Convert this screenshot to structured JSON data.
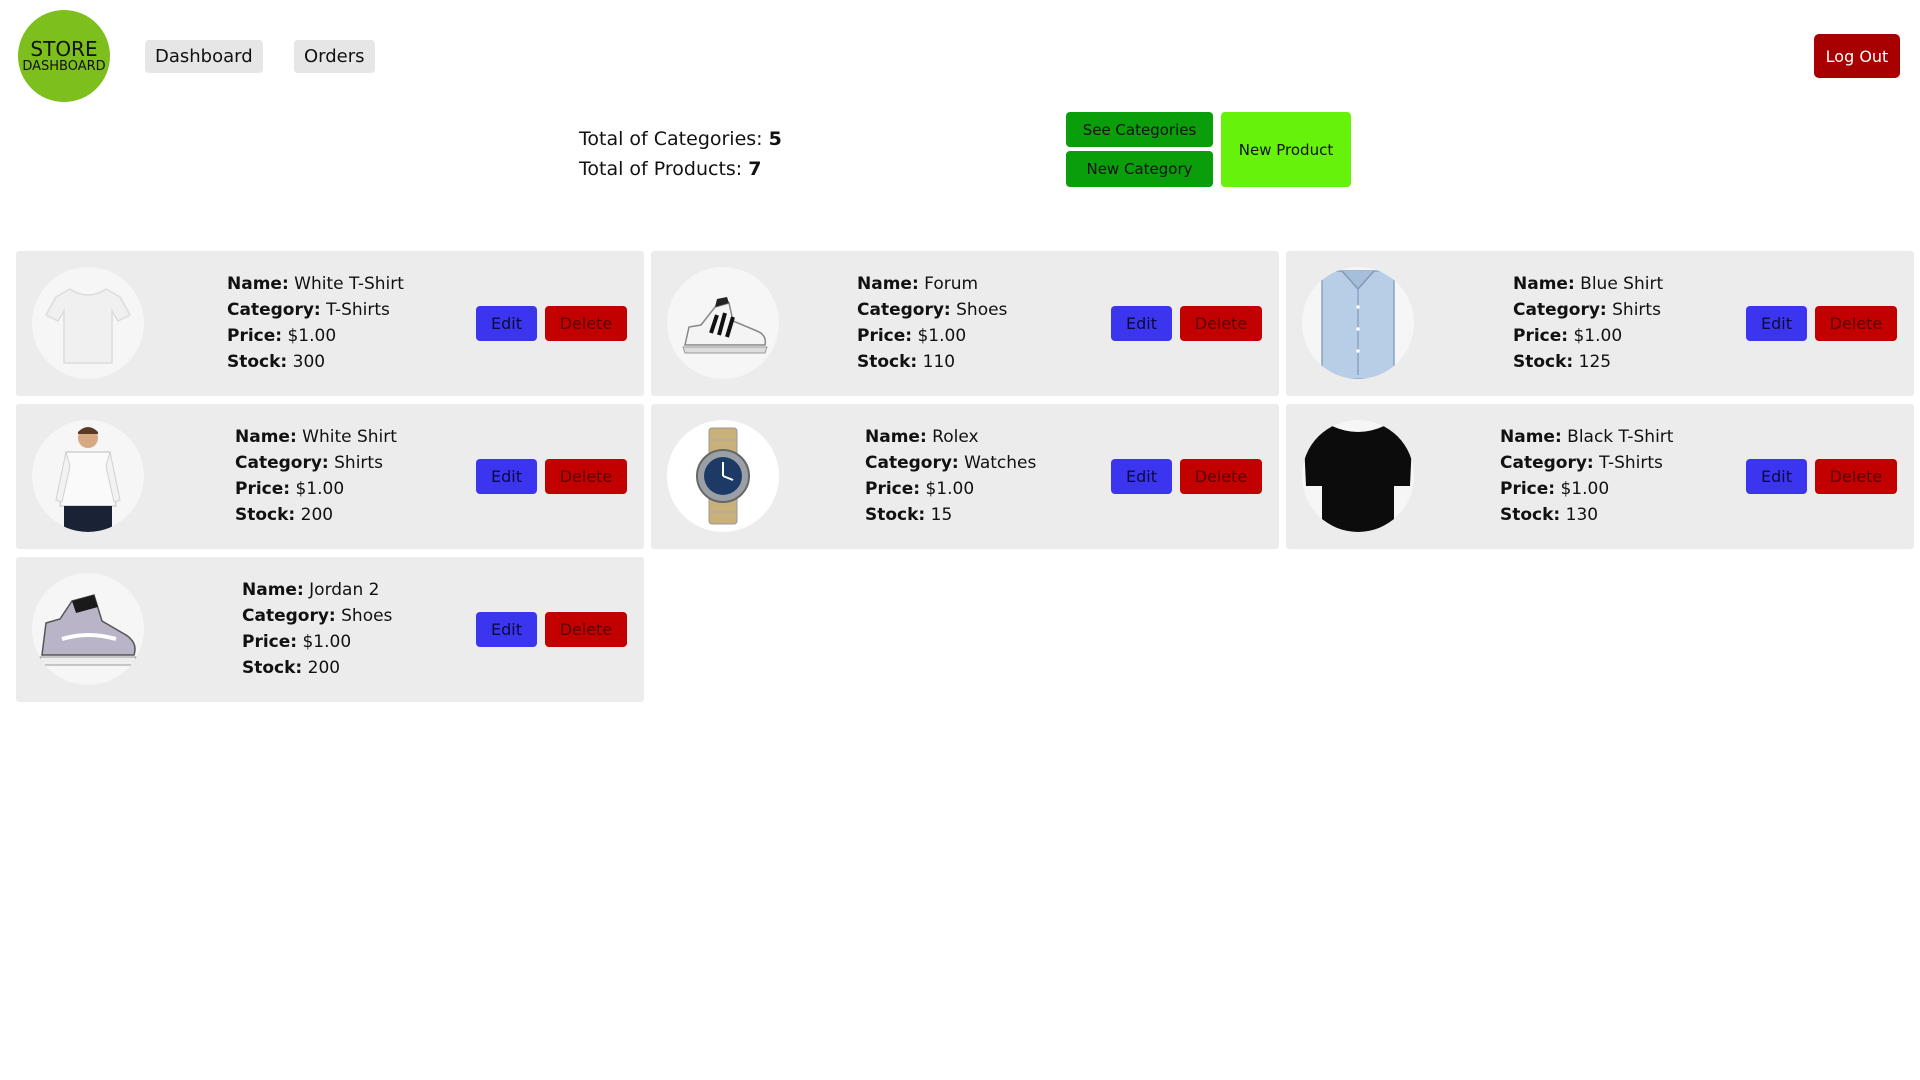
{
  "logo": {
    "line1": "STORE",
    "line2": "DASHBOARD"
  },
  "nav": {
    "dashboard": "Dashboard",
    "orders": "Orders",
    "logout": "Log Out"
  },
  "summary": {
    "categories_label": "Total of Categories:",
    "categories_value": "5",
    "products_label": "Total of Products:",
    "products_value": "7"
  },
  "actions": {
    "see_categories": "See Categories",
    "new_category": "New Category",
    "new_product": "New Product"
  },
  "labels": {
    "name": "Name:",
    "category": "Category:",
    "price": "Price:",
    "stock": "Stock:",
    "edit": "Edit",
    "delete": "Delete"
  },
  "products": [
    {
      "name": "White T-Shirt",
      "category": "T-Shirts",
      "price": "$1.00",
      "stock": "300",
      "image": "white-tshirt-icon"
    },
    {
      "name": "Forum",
      "category": "Shoes",
      "price": "$1.00",
      "stock": "110",
      "image": "sneaker-icon"
    },
    {
      "name": "Blue Shirt",
      "category": "Shirts",
      "price": "$1.00",
      "stock": "125",
      "image": "blue-shirt-icon"
    },
    {
      "name": "White Shirt",
      "category": "Shirts",
      "price": "$1.00",
      "stock": "200",
      "image": "white-shirt-model-icon"
    },
    {
      "name": "Rolex",
      "category": "Watches",
      "price": "$1.00",
      "stock": "15",
      "image": "watch-icon"
    },
    {
      "name": "Black T-Shirt",
      "category": "T-Shirts",
      "price": "$1.00",
      "stock": "130",
      "image": "black-tshirt-icon"
    },
    {
      "name": "Jordan 2",
      "category": "Shoes",
      "price": "$1.00",
      "stock": "200",
      "image": "high-top-sneaker-icon"
    }
  ],
  "colors": {
    "logo": "#7dbf1c",
    "logout": "#a80000",
    "green_button": "#0a9e0a",
    "new_product": "#66f20a",
    "edit": "#3b35f0",
    "delete": "#c30000",
    "card": "#ececec"
  }
}
